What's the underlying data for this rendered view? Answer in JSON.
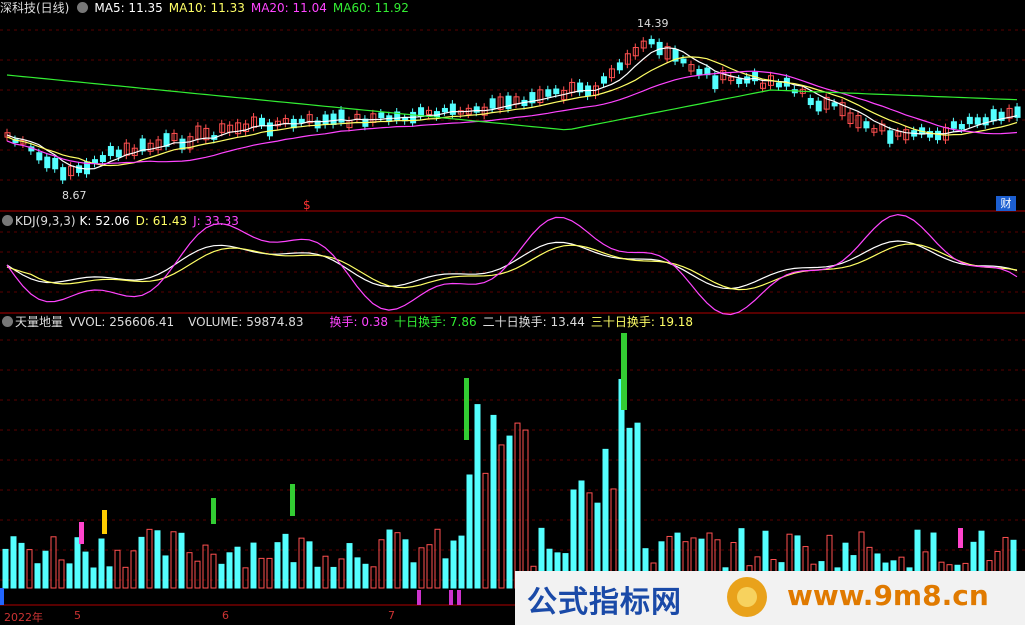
{
  "price_panel": {
    "title": "深科技(日线)",
    "indicators": [
      {
        "label": "MA5: 11.35",
        "color": "#ffffff"
      },
      {
        "label": "MA10: 11.33",
        "color": "#ffff66"
      },
      {
        "label": "MA20: 11.04",
        "color": "#ff44ff"
      },
      {
        "label": "MA60: 11.92",
        "color": "#33ee33"
      }
    ],
    "high_label": "14.39",
    "low_label": "8.67",
    "event_marker": "$",
    "event_badge": "财"
  },
  "kdj_panel": {
    "title": "KDJ(9,3,3)",
    "k": "K: 52.06",
    "d": "D: 61.43",
    "j": "J: 33.33",
    "colors": {
      "k": "#ffffff",
      "d": "#ffff66",
      "j": "#ff44ff"
    }
  },
  "volume_panel": {
    "title": "天量地量",
    "vvol": "VVOL: 256606.41",
    "volume": "VOLUME: 59874.83",
    "turnover": "换手: 0.38",
    "turnover10": "十日换手: 7.86",
    "turnover20": "二十日换手: 13.44",
    "turnover30": "三十日换手: 19.18"
  },
  "time_axis": [
    "2022年",
    "5",
    "6",
    "7"
  ],
  "watermark": {
    "left": "公式指标网",
    "right": "www.9m8.cn"
  }
}
